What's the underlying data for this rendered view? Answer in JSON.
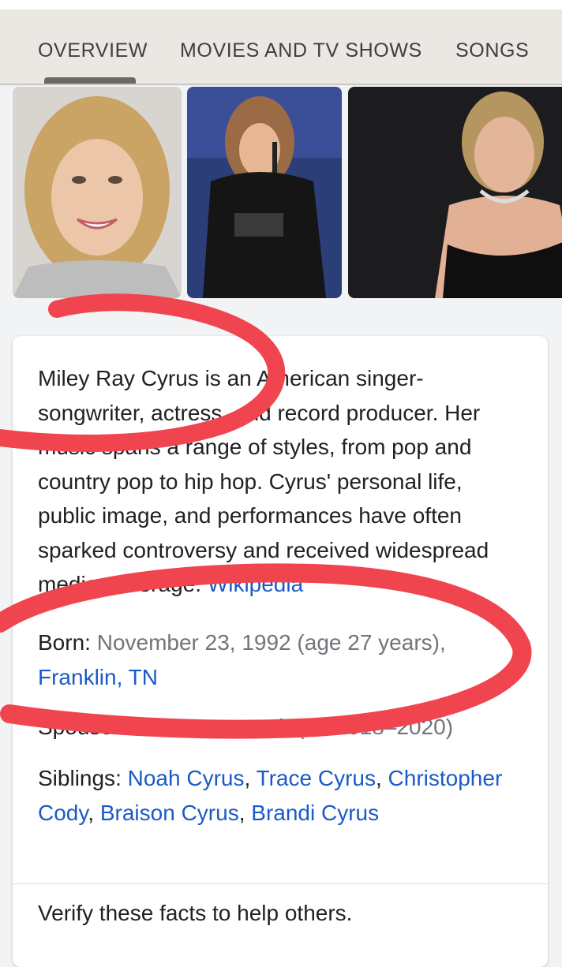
{
  "tabs": [
    {
      "label": "OVERVIEW",
      "active": true
    },
    {
      "label": "MOVIES AND TV SHOWS",
      "active": false
    },
    {
      "label": "SONGS",
      "active": false
    }
  ],
  "description": {
    "text": "Miley Ray Cyrus is an American singer-songwriter, actress, and record producer. Her music spans a range of styles, from pop and country pop to hip hop. Cyrus' personal life, public image, and performances have often sparked controversy and received widespread media coverage.",
    "source_link": "Wikipedia"
  },
  "facts": {
    "born": {
      "label": "Born",
      "value": "November 23, 1992 (age 27 years),",
      "place": "Franklin, TN"
    },
    "spouse": {
      "label": "Spouse",
      "value": "(m. 2018–2020)"
    },
    "siblings": {
      "label": "Siblings",
      "names": [
        "Noah Cyrus",
        "Trace Cyrus",
        "Christopher Cody",
        "Braison Cyrus",
        "Brandi Cyrus"
      ]
    }
  },
  "footer": {
    "verify_text": "Verify these facts to help others."
  },
  "colors": {
    "link": "#1a5ac7",
    "annotation": "#f0444f",
    "tabbar": "#ebe8e4"
  }
}
